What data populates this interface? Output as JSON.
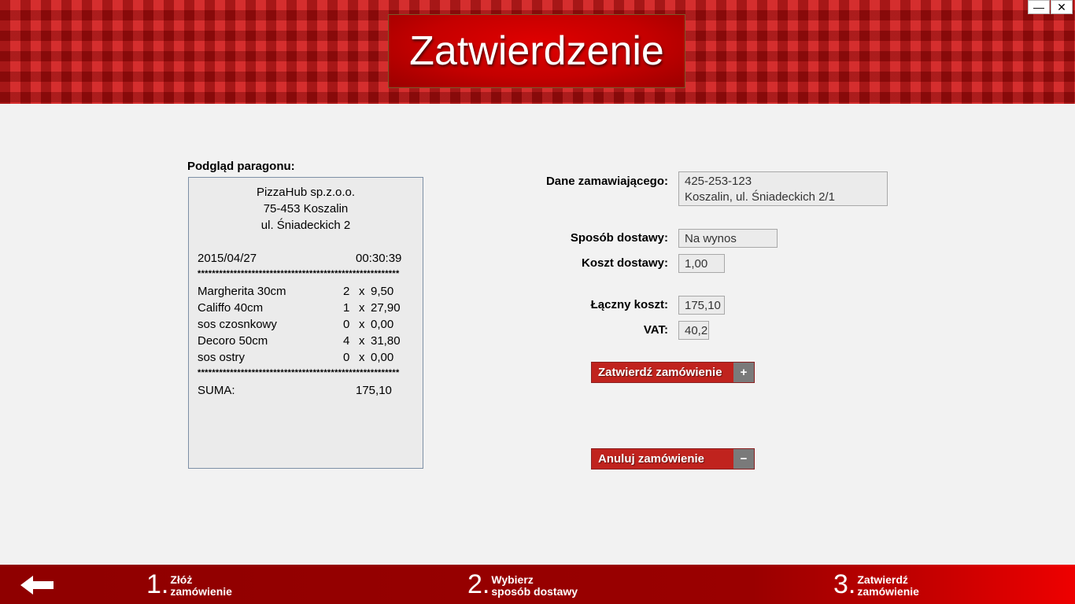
{
  "window": {
    "title": "Zatwierdzenie",
    "minimize": "—",
    "close": "✕"
  },
  "receipt": {
    "label": "Podgląd paragonu:",
    "company": "PizzaHub sp.z.o.o.",
    "address1": "75-453 Koszalin",
    "address2": "ul. Śniadeckich 2",
    "date": "2015/04/27",
    "time": "00:30:39",
    "separator": "********************************************************",
    "items": [
      {
        "name": "Margherita 30cm",
        "qty": "2",
        "x": "x",
        "price": "9,50"
      },
      {
        "name": "Califfo 40cm",
        "qty": "1",
        "x": "x",
        "price": "27,90"
      },
      {
        "name": "sos czosnkowy",
        "qty": "0",
        "x": "x",
        "price": "0,00"
      },
      {
        "name": "Decoro 50cm",
        "qty": "4",
        "x": "x",
        "price": "31,80"
      },
      {
        "name": "sos ostry",
        "qty": "0",
        "x": "x",
        "price": "0,00"
      }
    ],
    "sum_label": "SUMA:",
    "sum_value": "175,10"
  },
  "form": {
    "customer_label": "Dane zamawiającego:",
    "customer_phone": "425-253-123",
    "customer_address": "Koszalin, ul. Śniadeckich 2/1",
    "delivery_method_label": "Sposób dostawy:",
    "delivery_method_value": "Na wynos",
    "delivery_cost_label": "Koszt dostawy:",
    "delivery_cost_value": "1,00",
    "total_label": "Łączny koszt:",
    "total_value": "175,10",
    "vat_label": "VAT:",
    "vat_value": "40,2"
  },
  "actions": {
    "confirm_label": "Zatwierdź zamówienie",
    "confirm_icon": "+",
    "cancel_label": "Anuluj zamówienie",
    "cancel_icon": "−"
  },
  "footer": {
    "steps": [
      {
        "num": "1.",
        "line1": "Złóż",
        "line2": "zamówienie"
      },
      {
        "num": "2.",
        "line1": "Wybierz",
        "line2": "sposób dostawy"
      },
      {
        "num": "3.",
        "line1": "Zatwierdź",
        "line2": "zamówienie"
      }
    ]
  },
  "colors": {
    "brand_red": "#c0231e",
    "header_red": "#c81818",
    "footer_red": "#9a0000"
  }
}
